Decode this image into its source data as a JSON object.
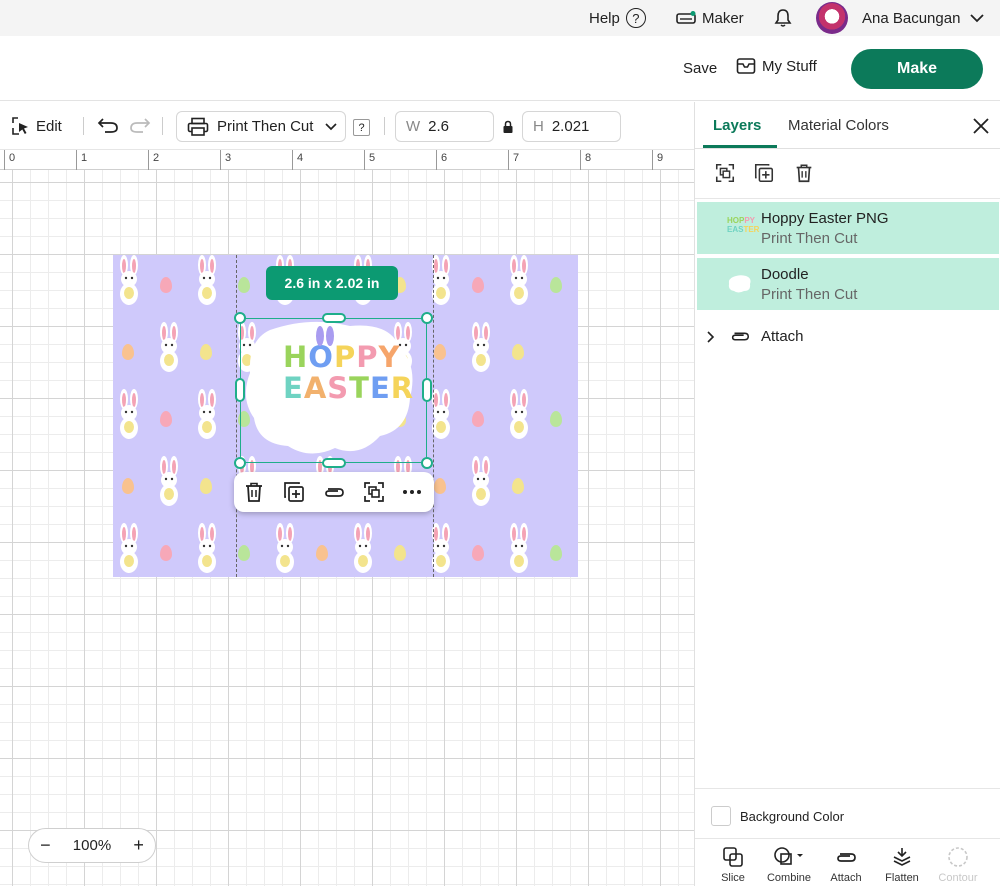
{
  "topbar": {
    "help_label": "Help",
    "help_icon": "question-circle-icon",
    "machine_label": "Maker",
    "user_name": "Ana Bacungan"
  },
  "header": {
    "save_label": "Save",
    "mystuff_label": "My Stuff",
    "make_label": "Make"
  },
  "toolbar": {
    "edit_label": "Edit",
    "operation_label": "Print Then Cut",
    "help_badge": "?",
    "width_label": "W",
    "width_value": "2.6",
    "height_label": "H",
    "height_value": "2.021"
  },
  "ruler": {
    "numbers": [
      "0",
      "1",
      "2",
      "3",
      "4",
      "5",
      "6",
      "7",
      "8",
      "9"
    ]
  },
  "canvas": {
    "size_tag": "2.6  in x 2.02  in",
    "zoom_minus": "−",
    "zoom_value": "100%",
    "zoom_plus": "+",
    "artwork_line1": "HOPPY",
    "artwork_line2": "EASTER",
    "colors": {
      "design_bg": "#cfc9fb",
      "selection": "#1fae8a",
      "accent": "#0c7a5a"
    }
  },
  "panel": {
    "tabs": [
      {
        "label": "Layers",
        "active": true
      },
      {
        "label": "Material Colors",
        "active": false
      }
    ],
    "layers": [
      {
        "name": "Hoppy Easter PNG",
        "operation": "Print Then Cut",
        "selected": true
      },
      {
        "name": "Doodle",
        "operation": "Print Then Cut",
        "selected": true
      }
    ],
    "attach_group_label": "Attach",
    "background_color_label": "Background Color",
    "tools": [
      "Slice",
      "Combine",
      "Attach",
      "Flatten",
      "Contour"
    ]
  }
}
